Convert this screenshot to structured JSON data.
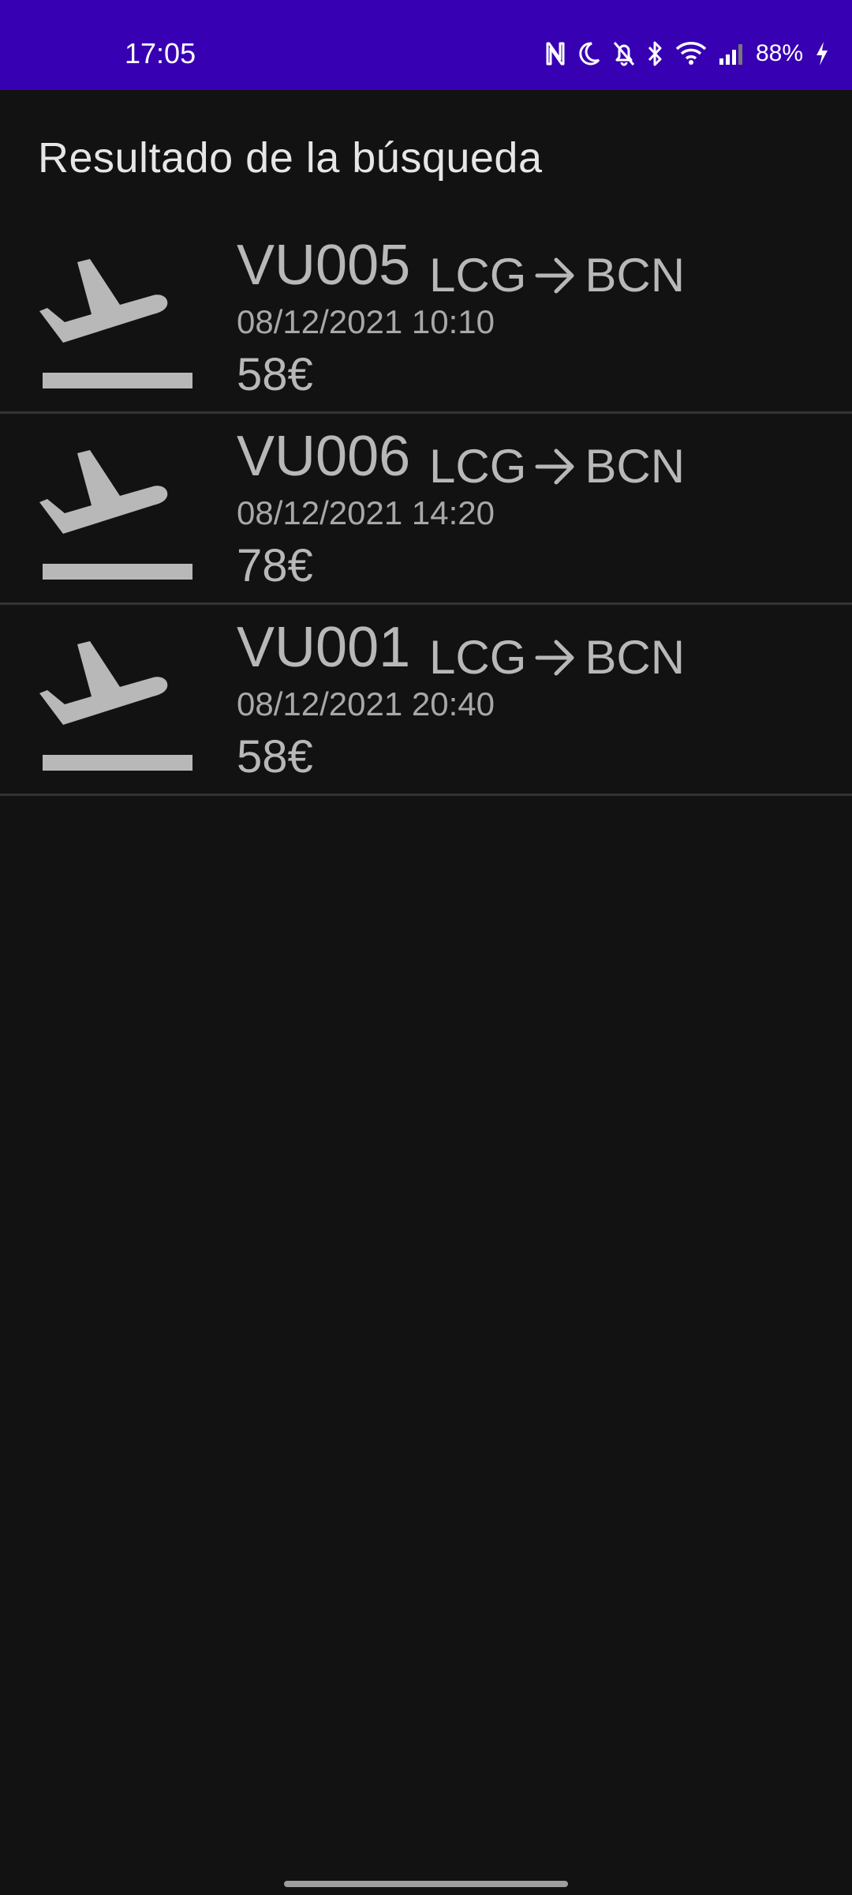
{
  "status_bar": {
    "time": "17:05",
    "battery": "88%",
    "background_color": "#3700b3",
    "icons": [
      "nfc-icon",
      "do-not-disturb-moon-icon",
      "notifications-off-icon",
      "bluetooth-icon",
      "wifi-icon",
      "cell-signal-icon",
      "battery-charging-icon"
    ]
  },
  "page": {
    "title": "Resultado de la búsqueda"
  },
  "flights": [
    {
      "code": "VU005",
      "origin": "LCG",
      "destination": "BCN",
      "datetime": "08/12/2021 10:10",
      "price": "58€",
      "icon": "flight-takeoff-icon"
    },
    {
      "code": "VU006",
      "origin": "LCG",
      "destination": "BCN",
      "datetime": "08/12/2021 14:20",
      "price": "78€",
      "icon": "flight-takeoff-icon"
    },
    {
      "code": "VU001",
      "origin": "LCG",
      "destination": "BCN",
      "datetime": "08/12/2021 20:40",
      "price": "58€",
      "icon": "flight-takeoff-icon"
    }
  ],
  "colors": {
    "background": "#121212",
    "text_primary": "#b8b8b8",
    "divider": "#333333"
  }
}
